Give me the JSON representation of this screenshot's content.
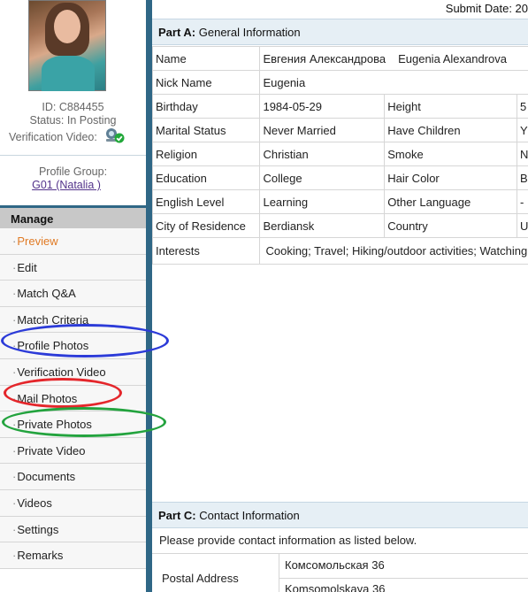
{
  "profile": {
    "id_text": "ID: C884455",
    "status_text": "Status: In Posting",
    "verification_label": "Verification Video:",
    "group_label": "Profile Group:",
    "group_link": "G01 (Natalia )"
  },
  "sidebar": {
    "heading": "Manage",
    "items": [
      {
        "label": "Preview"
      },
      {
        "label": "Edit"
      },
      {
        "label": "Match Q&A"
      },
      {
        "label": "Match Criteria"
      },
      {
        "label": "Profile Photos"
      },
      {
        "label": "Verification Video"
      },
      {
        "label": "Mail Photos"
      },
      {
        "label": "Private Photos"
      },
      {
        "label": "Private Video"
      },
      {
        "label": "Documents"
      },
      {
        "label": "Videos"
      },
      {
        "label": "Settings"
      },
      {
        "label": "Remarks"
      }
    ]
  },
  "header": {
    "submit_date": "Submit Date: 20"
  },
  "partA": {
    "title_bold": "Part A:",
    "title_rest": " General Information",
    "name_label": "Name",
    "name_cyrillic": "Евгения Александрова",
    "name_latin": "Eugenia Alexandrova",
    "nick_label": "Nick Name",
    "nick_value": "Eugenia",
    "rows": [
      {
        "l1": "Birthday",
        "v1": "1984-05-29",
        "l2": "Height",
        "v2": "5"
      },
      {
        "l1": "Marital Status",
        "v1": "Never Married",
        "l2": "Have Children",
        "v2": "Y"
      },
      {
        "l1": "Religion",
        "v1": "Christian",
        "l2": "Smoke",
        "v2": "N"
      },
      {
        "l1": "Education",
        "v1": "College",
        "l2": "Hair Color",
        "v2": "B"
      },
      {
        "l1": "English Level",
        "v1": "Learning",
        "l2": "Other Language",
        "v2": "-"
      },
      {
        "l1": "City of Residence",
        "v1": "Berdiansk",
        "l2": "Country",
        "v2": "U"
      }
    ],
    "interests_label": "Interests",
    "interests_value": "Cooking; Travel; Hiking/outdoor activities; Watching"
  },
  "partC": {
    "title_bold": "Part C:",
    "title_rest": " Contact Information",
    "note": "Please provide contact information as listed below.",
    "postal_label": "Postal Address",
    "postal_line1": "Комсомольская 36",
    "postal_line2": "Komsomolskaya 36"
  },
  "annotations": {
    "blue": "#2c3bd8",
    "red": "#e4262b",
    "green": "#23a33e"
  }
}
